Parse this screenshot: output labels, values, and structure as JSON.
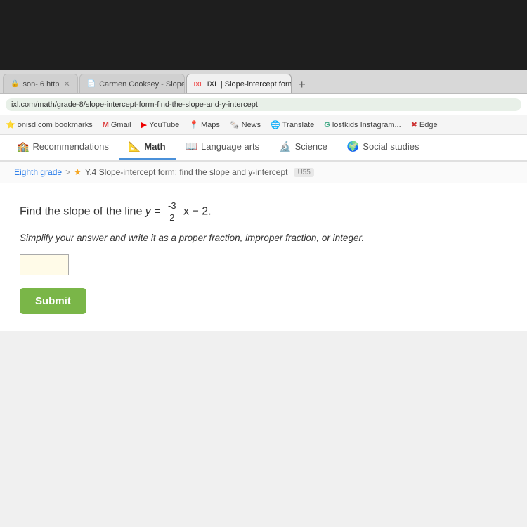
{
  "browser": {
    "tabs": [
      {
        "id": "tab1",
        "label": "son- 6 http",
        "icon": "🔒",
        "active": false
      },
      {
        "id": "tab2",
        "label": "Carmen Cooksey - Slope from Ta",
        "icon": "📄",
        "active": false
      },
      {
        "id": "tab3",
        "label": "IXL | Slope-intercept form: find th",
        "icon": "IXL",
        "active": true
      },
      {
        "id": "tab4",
        "label": "+",
        "icon": "",
        "active": false
      }
    ],
    "address": "ixl.com/math/grade-8/slope-intercept-form-find-the-slope-and-y-intercept"
  },
  "bookmarks": [
    {
      "label": "onisd.com bookmarks",
      "icon": "⭐"
    },
    {
      "label": "Gmail",
      "icon": "M"
    },
    {
      "label": "YouTube",
      "icon": "▶"
    },
    {
      "label": "Maps",
      "icon": "📍"
    },
    {
      "label": "News",
      "icon": "📰"
    },
    {
      "label": "Translate",
      "icon": "🌐"
    },
    {
      "label": "lostkids Instagram...",
      "icon": "G"
    },
    {
      "label": "Edge",
      "icon": "✖"
    }
  ],
  "subject_nav": {
    "tabs": [
      {
        "label": "Recommendations",
        "icon": "🏫",
        "active": false
      },
      {
        "label": "Math",
        "icon": "📐",
        "active": true
      },
      {
        "label": "Language arts",
        "icon": "📖",
        "active": false
      },
      {
        "label": "Science",
        "icon": "🔬",
        "active": false
      },
      {
        "label": "Social studies",
        "icon": "🌍",
        "active": false
      }
    ]
  },
  "breadcrumb": {
    "grade": "Eighth grade",
    "separator": ">",
    "star": "★",
    "skill": "Y.4 Slope-intercept form: find the slope and y-intercept",
    "badge": "U55"
  },
  "question": {
    "prefix": "Find the slope of the line",
    "equation": "y = ",
    "numerator": "-3",
    "denominator": "2",
    "suffix": "x − 2.",
    "instruction": "Simplify your answer and write it as a proper fraction, improper fraction, or integer."
  },
  "form": {
    "input_placeholder": "",
    "submit_label": "Submit"
  }
}
